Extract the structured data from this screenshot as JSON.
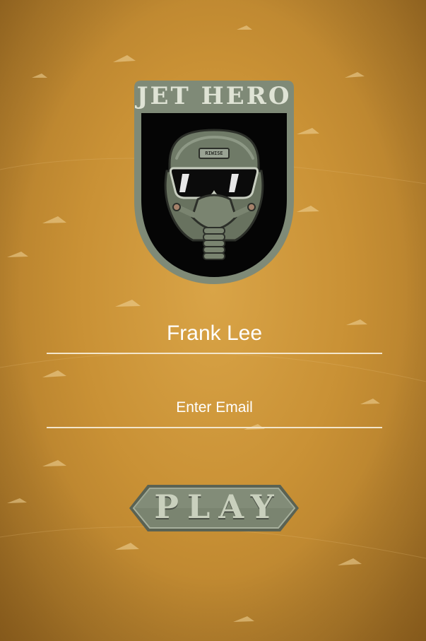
{
  "app": {
    "logo_text": "JET HERO",
    "helmet_text": "RIWISE"
  },
  "form": {
    "name_value": "Frank Lee",
    "email_placeholder": "Enter Email"
  },
  "actions": {
    "play_label": "PLAY"
  },
  "colors": {
    "background": "#c99135",
    "badge": "#7f8a77",
    "badge_dark": "#000000",
    "text_light": "#ffffff",
    "button": "#7a8470"
  }
}
